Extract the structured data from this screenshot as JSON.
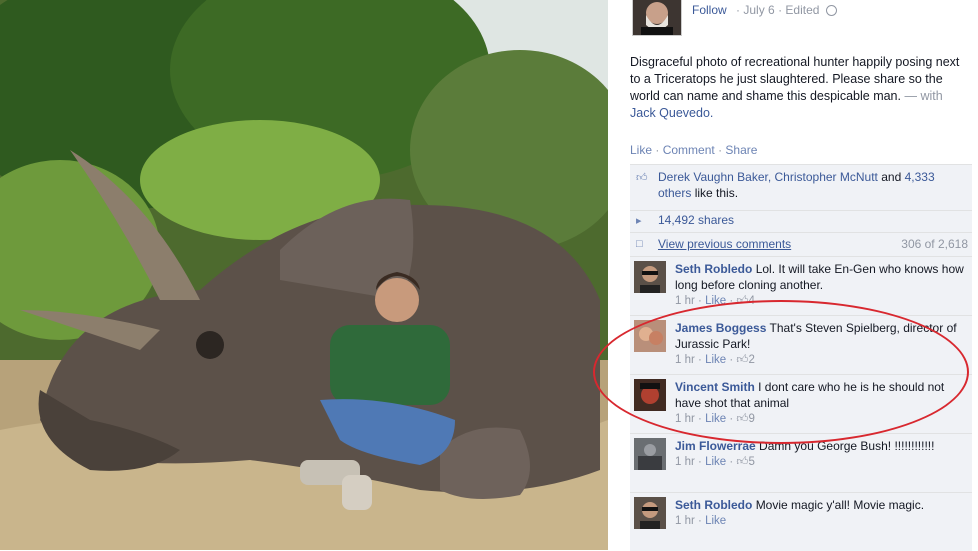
{
  "post": {
    "follow_label": "Follow",
    "date": "July 6",
    "edited": "Edited",
    "text": "Disgraceful photo of recreational hunter happily posing next to a Triceratops he just slaughtered. Please share so the world can name and shame this despicable man.",
    "with_prefix": "— with",
    "with_name": "Jack Quevedo."
  },
  "actions": {
    "like": "Like",
    "comment": "Comment",
    "share": "Share",
    "sep": "·"
  },
  "likes": {
    "names": "Derek Vaughn Baker, Christopher McNutt",
    "and": "and",
    "others_link": "4,333 others",
    "suffix": "like this."
  },
  "shares": {
    "label": "14,492 shares"
  },
  "previous": {
    "label": "View previous comments",
    "count": "306 of 2,618"
  },
  "comments": [
    {
      "name": "Seth Robledo",
      "text": "Lol. It will take En-Gen who knows how long before cloning another.",
      "time": "1 hr",
      "like": "Like",
      "likes": "4"
    },
    {
      "name": "James Boggess",
      "text": "That's Steven Spielberg, director of Jurassic Park!",
      "time": "1 hr",
      "like": "Like",
      "likes": "2"
    },
    {
      "name": "Vincent Smith",
      "text": "I dont care who he is he should not have shot that animal",
      "time": "1 hr",
      "like": "Like",
      "likes": "9"
    },
    {
      "name": "Jim Flowerrae",
      "text": "Damn you George Bush! !!!!!!!!!!!!",
      "time": "1 hr",
      "like": "Like",
      "likes": "5"
    },
    {
      "name": "Seth Robledo",
      "text": "Movie magic y'all! Movie magic.",
      "time": "1 hr",
      "like": "Like",
      "likes": ""
    }
  ],
  "icons": [
    "thumbs-up-icon",
    "share-icon",
    "comment-icon",
    "globe-icon"
  ],
  "colors": {
    "link": "#3b5998",
    "meta": "#9197a3",
    "ufi_bg": "#f0f2f6",
    "highlight_ring": "#d8282f"
  }
}
